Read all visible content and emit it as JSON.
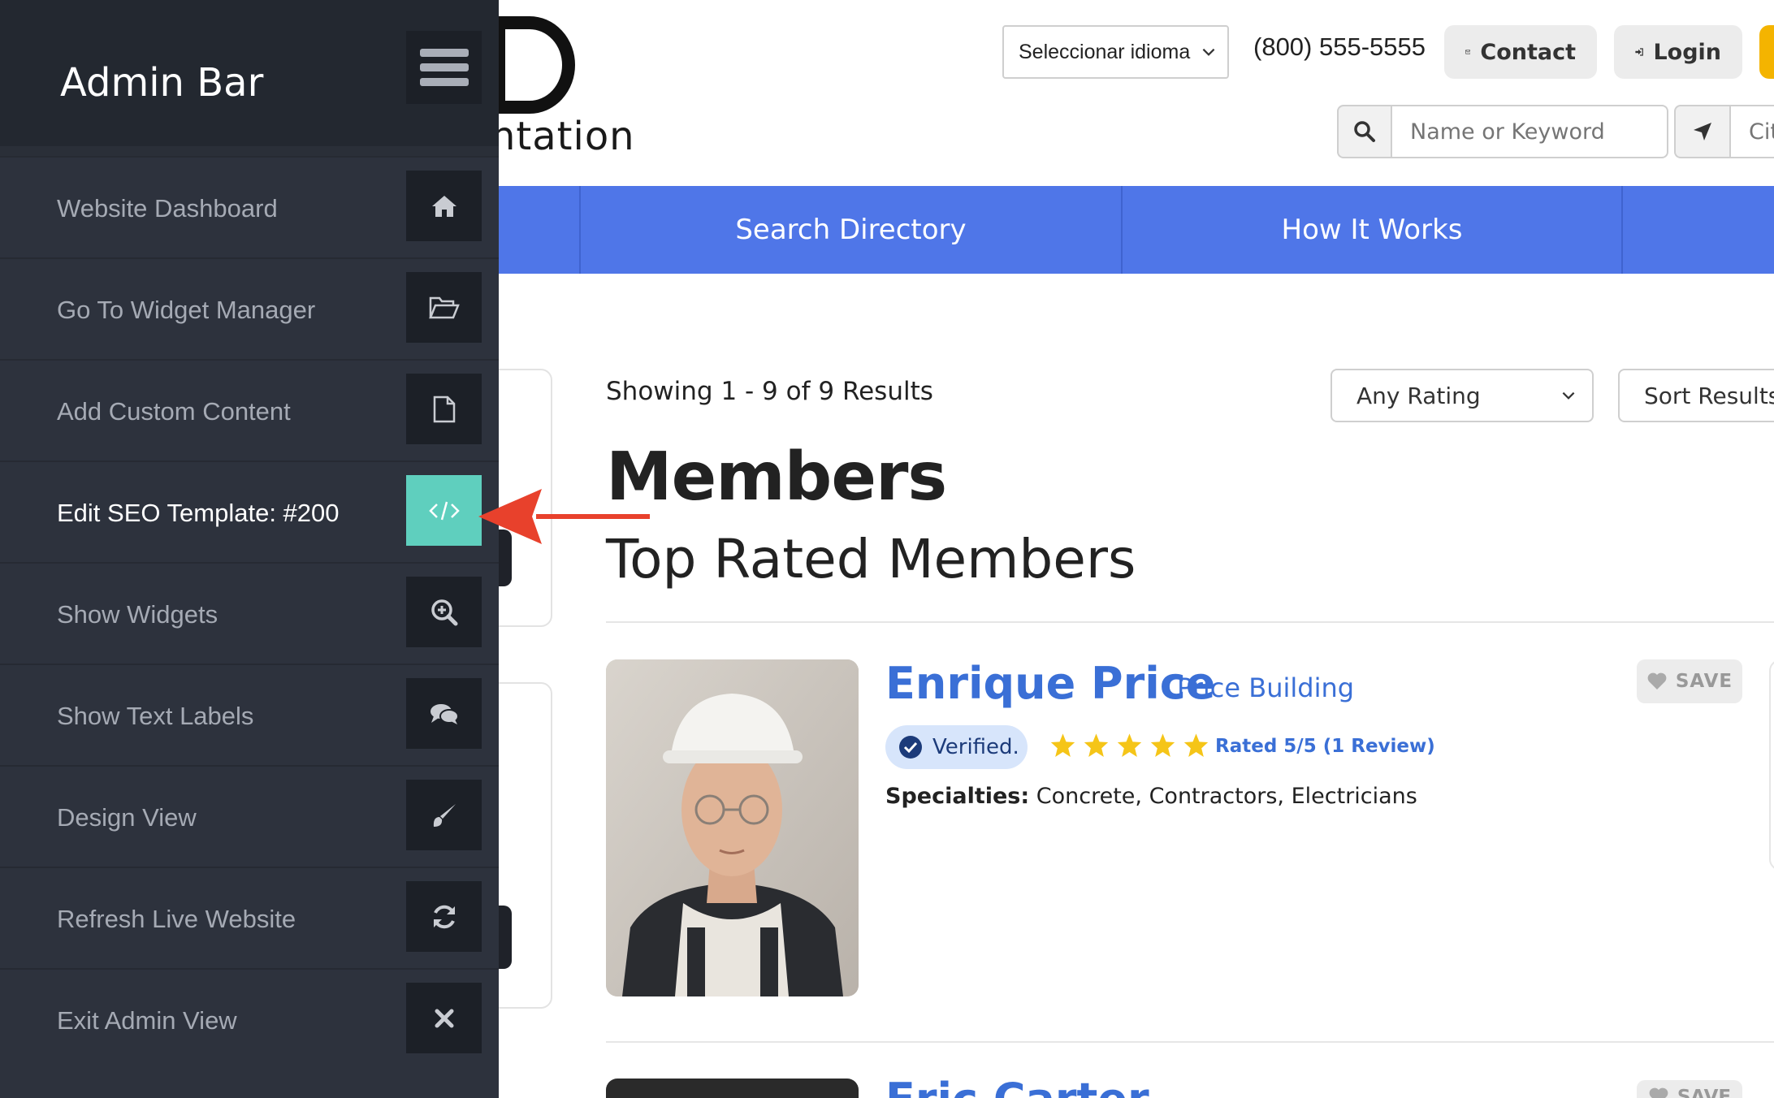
{
  "admin_bar": {
    "title": "Admin Bar",
    "items": [
      {
        "label": "Website Dashboard",
        "icon": "home-icon"
      },
      {
        "label": "Go To Widget Manager",
        "icon": "folder-open-icon"
      },
      {
        "label": "Add Custom Content",
        "icon": "file-icon"
      },
      {
        "label": "Edit SEO Template: #200",
        "icon": "code-icon",
        "active": true
      },
      {
        "label": "Show Widgets",
        "icon": "zoom-in-icon"
      },
      {
        "label": "Show Text Labels",
        "icon": "comments-icon"
      },
      {
        "label": "Design View",
        "icon": "paint-brush-icon"
      },
      {
        "label": "Refresh Live Website",
        "icon": "refresh-icon"
      },
      {
        "label": "Exit Admin View",
        "icon": "close-icon"
      }
    ]
  },
  "header": {
    "logo_text": "ntation",
    "language_select": "Seleccionar idioma",
    "phone": "(800) 555-5555",
    "contact_label": "Contact",
    "login_label": "Login",
    "search_placeholder": "Name or Keyword",
    "location_placeholder": "City"
  },
  "nav": {
    "items": [
      "Search Directory",
      "How It Works"
    ]
  },
  "results": {
    "count_text": "Showing 1 - 9 of 9 Results",
    "rating_filter": "Any Rating",
    "sort_label": "Sort Results",
    "title": "Members",
    "subtitle": "Top Rated Members"
  },
  "members": [
    {
      "name": "Enrique Price",
      "company": "Price Building",
      "verified_label": "Verified.",
      "stars": 5,
      "rating_text": "Rated 5/5 (1 Review)",
      "specialties_label": "Specialties:",
      "specialties": "Concrete, Contractors, Electricians",
      "save_label": "SAVE"
    },
    {
      "name": "Eric Carter",
      "save_label": "SAVE"
    }
  ],
  "colors": {
    "admin_bg": "#2d323d",
    "active_teal": "#5fcfbe",
    "nav_blue": "#4f76e8",
    "link_blue": "#3a6fd6",
    "star_yellow": "#f5c518",
    "arrow_red": "#e8412c"
  }
}
